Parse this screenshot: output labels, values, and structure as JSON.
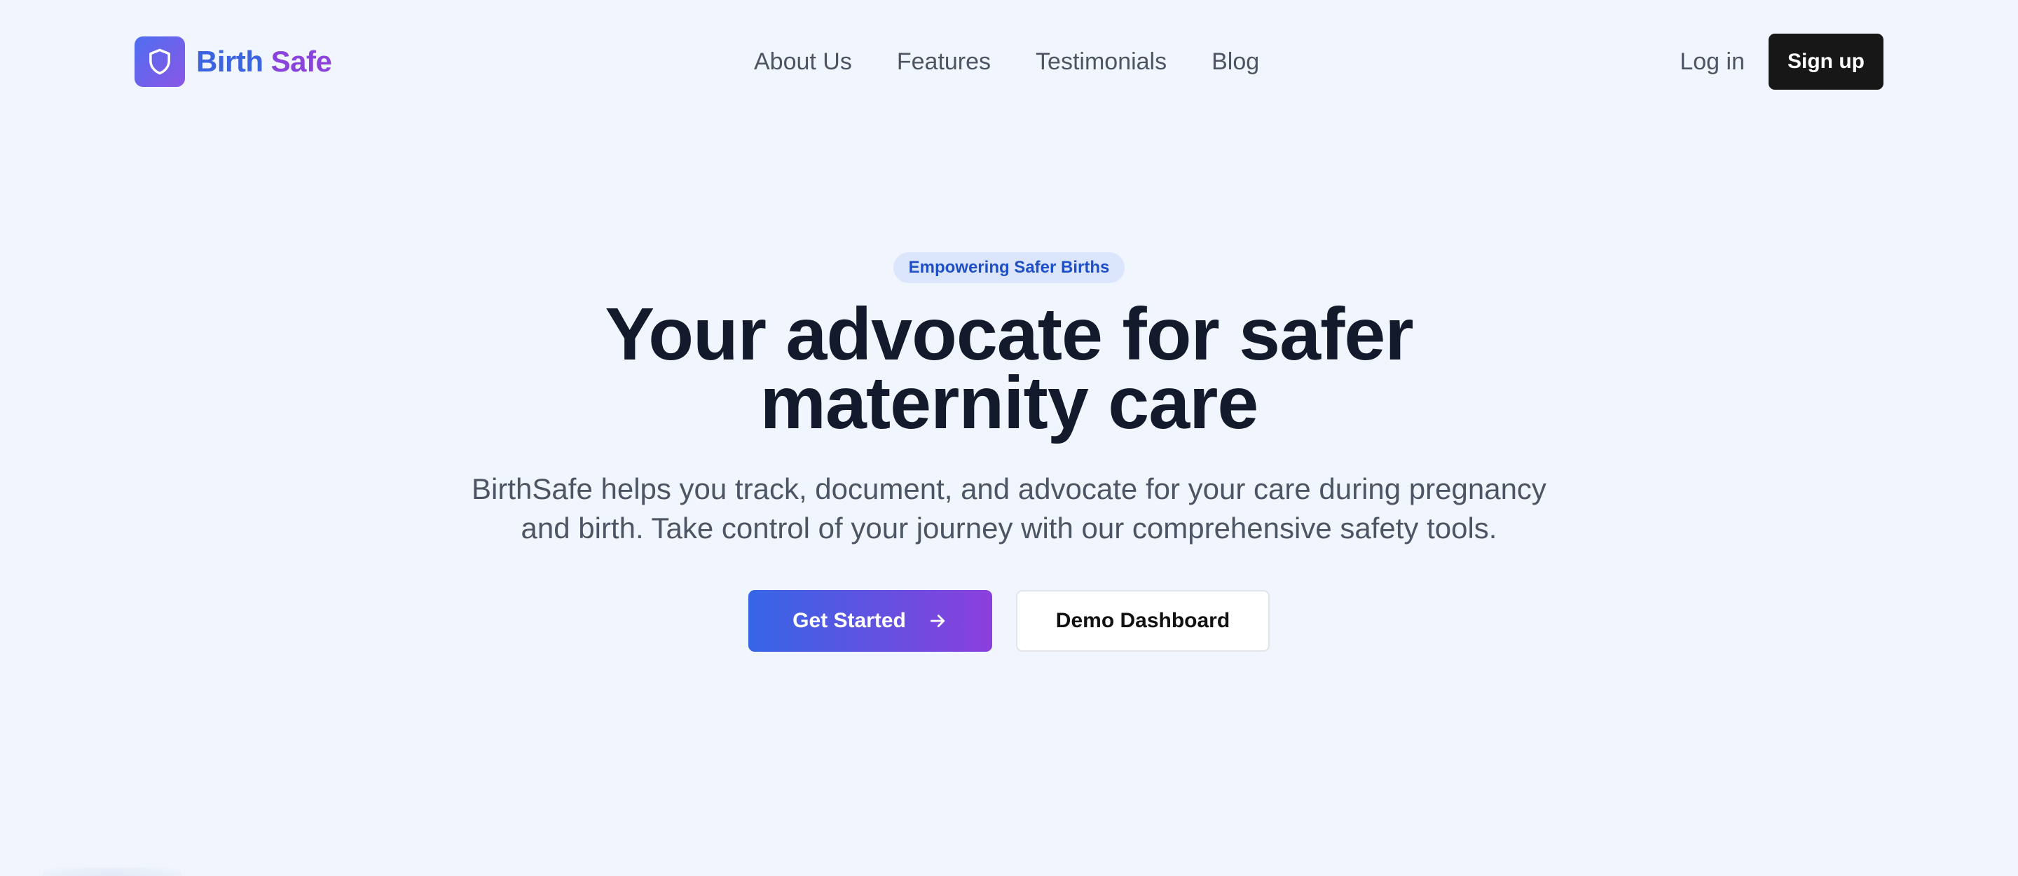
{
  "brand": {
    "name_part1": "Birth",
    "name_part2": "Safe",
    "logo_icon": "shield-icon",
    "colors": {
      "primary_blue": "#3c63e0",
      "primary_purple": "#8a44db",
      "background": "#f0f5fe",
      "dark_button": "#171717"
    }
  },
  "nav": {
    "links": [
      {
        "label": "About Us"
      },
      {
        "label": "Features"
      },
      {
        "label": "Testimonials"
      },
      {
        "label": "Blog"
      }
    ]
  },
  "auth": {
    "login_label": "Log in",
    "signup_label": "Sign up"
  },
  "hero": {
    "badge": "Empowering Safer Births",
    "title_line1": "Your advocate for safer",
    "title_line2": "maternity care",
    "subtitle": "BirthSafe helps you track, document, and advocate for your care during pregnancy and birth. Take control of your journey with our comprehensive safety tools.",
    "primary_cta": "Get Started",
    "primary_cta_icon": "arrow-right-icon",
    "secondary_cta": "Demo Dashboard"
  }
}
